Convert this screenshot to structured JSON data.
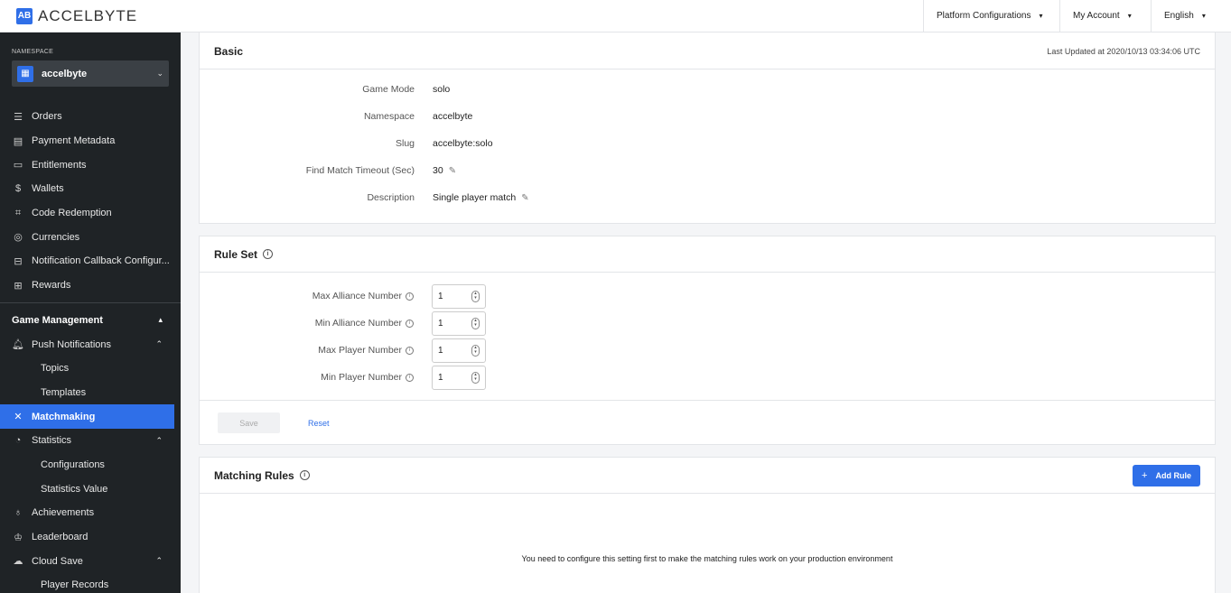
{
  "brand": {
    "logo_mark": "AB",
    "name": "ACCELBYTE",
    "accent": "#2f6fe8"
  },
  "topnav": {
    "items": [
      "Platform Configurations",
      "My Account",
      "English"
    ]
  },
  "sidebar": {
    "namespace_label": "NAMESPACE",
    "namespace_value": "accelbyte",
    "items": [
      {
        "label": "Orders",
        "icon": "orders-icon"
      },
      {
        "label": "Payment Metadata",
        "icon": "payment-metadata-icon"
      },
      {
        "label": "Entitlements",
        "icon": "entitlements-icon"
      },
      {
        "label": "Wallets",
        "icon": "dollar-icon"
      },
      {
        "label": "Code Redemption",
        "icon": "code-icon"
      },
      {
        "label": "Currencies",
        "icon": "currency-icon"
      },
      {
        "label": "Notification Callback Configur...",
        "icon": "callback-icon"
      },
      {
        "label": "Rewards",
        "icon": "gift-icon"
      }
    ],
    "section": "Game Management",
    "game_items": [
      {
        "label": "Push Notifications",
        "icon": "bell-icon"
      },
      {
        "label": "Topics"
      },
      {
        "label": "Templates"
      },
      {
        "label": "Matchmaking",
        "icon": "matchmaking-icon",
        "active": true
      },
      {
        "label": "Statistics",
        "icon": "statistics-icon"
      },
      {
        "label": "Configurations"
      },
      {
        "label": "Statistics Value"
      },
      {
        "label": "Achievements",
        "icon": "medal-icon"
      },
      {
        "label": "Leaderboard",
        "icon": "crown-icon"
      },
      {
        "label": "Cloud Save",
        "icon": "cloud-icon"
      },
      {
        "label": "Player Records"
      }
    ]
  },
  "basic": {
    "title": "Basic",
    "last_updated": "Last Updated at 2020/10/13 03:34:06 UTC",
    "fields": [
      {
        "label": "Game Mode",
        "value": "solo"
      },
      {
        "label": "Namespace",
        "value": "accelbyte"
      },
      {
        "label": "Slug",
        "value": "accelbyte:solo"
      },
      {
        "label": "Find Match Timeout (Sec)",
        "value": "30"
      },
      {
        "label": "Description",
        "value": "Single player match"
      }
    ]
  },
  "ruleset": {
    "title": "Rule Set",
    "fields": [
      {
        "label": "Max Alliance Number",
        "value": "1"
      },
      {
        "label": "Min Alliance Number",
        "value": "1"
      },
      {
        "label": "Max Player Number",
        "value": "1"
      },
      {
        "label": "Min Player Number",
        "value": "1"
      }
    ],
    "save_label": "Save",
    "reset_label": "Reset"
  },
  "matching_rules": {
    "title": "Matching Rules",
    "add_label": "Add Rule",
    "empty_message": "You need to configure this setting first to make the matching rules work on your production environment"
  }
}
